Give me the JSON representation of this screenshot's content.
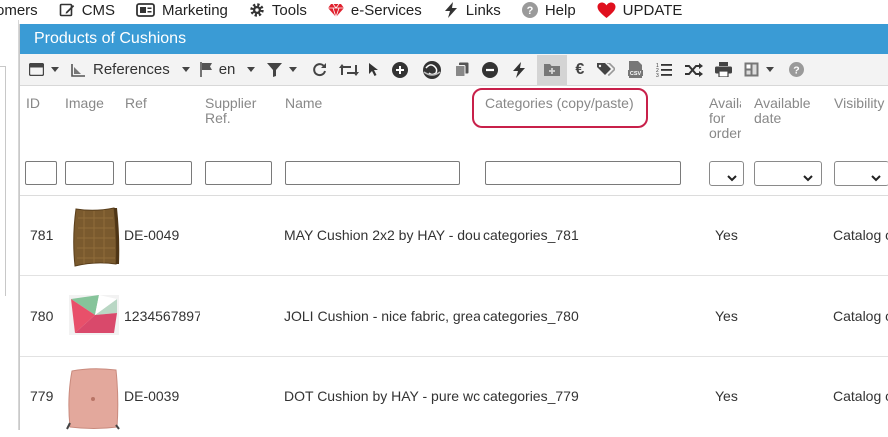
{
  "top_menu": [
    {
      "label": "omers",
      "icon": "user-icon"
    },
    {
      "label": "CMS",
      "icon": "edit-icon"
    },
    {
      "label": "Marketing",
      "icon": "billboard-icon"
    },
    {
      "label": "Tools",
      "icon": "gear-icon"
    },
    {
      "label": "e-Services",
      "icon": "diamond-icon"
    },
    {
      "label": "Links",
      "icon": "bolt-icon"
    },
    {
      "label": "Help",
      "icon": "help-icon"
    },
    {
      "label": "UPDATE",
      "icon": "heart-icon"
    }
  ],
  "panel": {
    "title": "Products of Cushions",
    "accent": "#3a9bd5"
  },
  "toolbar": {
    "view_icon": "window-icon",
    "references_label": "References",
    "language_label": "en",
    "filter_icon": "filter-icon",
    "icons": [
      "refresh-icon",
      "sync-icon",
      "cursor-icon",
      "add-icon",
      "globe-icon",
      "copy-icon",
      "remove-icon",
      "lightning-icon",
      "folder-add-icon",
      "euro-icon",
      "tags-icon",
      "csv-icon",
      "numbered-list-icon",
      "shuffle-icon",
      "print-icon",
      "layout-icon",
      "help-icon"
    ]
  },
  "columns": {
    "id": "ID",
    "image": "Image",
    "ref": "Ref",
    "supplier_ref": "Supplier Ref.",
    "name": "Name",
    "categories": "Categories (copy/paste)",
    "available_for_order": "Available for order",
    "available_date": "Available date",
    "visibility": "Visibility"
  },
  "rows": [
    {
      "id": "781",
      "ref": "DE-0049",
      "supplier_ref": "",
      "name": "MAY Cushion 2x2 by HAY - dou",
      "categories": "categories_781",
      "available": "Yes",
      "visibility": "Catalog o",
      "thumb": "brown-cushion"
    },
    {
      "id": "780",
      "ref": "1234567897",
      "supplier_ref": "",
      "name": "JOLI Cushion - nice fabric, grea",
      "categories": "categories_780",
      "available": "Yes",
      "visibility": "Catalog o",
      "thumb": "geometric-cushion"
    },
    {
      "id": "779",
      "ref": "DE-0039",
      "supplier_ref": "",
      "name": "DOT Cushion by HAY - pure wc",
      "categories": "categories_779",
      "available": "Yes",
      "visibility": "Catalog o",
      "thumb": "pink-cushion"
    }
  ]
}
